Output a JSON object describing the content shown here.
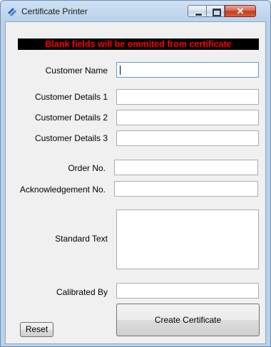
{
  "window": {
    "title": "Certificate Printer",
    "minimize_glyph": "",
    "maximize_glyph": "",
    "close_glyph": "✕"
  },
  "banner": {
    "text": "Blank fields will be ommited from certificate",
    "text_color": "#ff0000",
    "bg_color": "#000000"
  },
  "form": {
    "customer_name": {
      "label": "Customer Name",
      "value": ""
    },
    "customer_details_1": {
      "label": "Customer Details 1",
      "value": ""
    },
    "customer_details_2": {
      "label": "Customer Details 2",
      "value": ""
    },
    "customer_details_3": {
      "label": "Customer Details 3",
      "value": ""
    },
    "order_no": {
      "label": "Order No.",
      "value": ""
    },
    "acknowledgement_no": {
      "label": "Acknowledgement No.",
      "value": ""
    },
    "standard_text": {
      "label": "Standard Text",
      "value": ""
    },
    "calibrated_by": {
      "label": "Calibrated By",
      "value": ""
    }
  },
  "buttons": {
    "reset": "Reset",
    "create": "Create Certificate"
  },
  "icons": {
    "app": "diamond-app-icon",
    "minimize": "minimize-icon",
    "maximize": "maximize-icon",
    "close": "close-icon"
  }
}
